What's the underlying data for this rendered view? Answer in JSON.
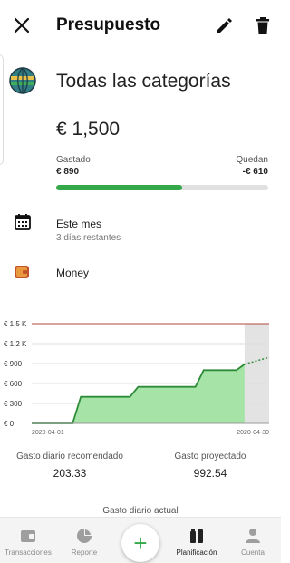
{
  "header": {
    "title": "Presupuesto"
  },
  "budget": {
    "category": "Todas las categorías",
    "amount": "€ 1,500",
    "spent_label": "Gastado",
    "spent_value": "€ 890",
    "remaining_label": "Quedan",
    "remaining_value": "-€ 610",
    "progress": 0.593,
    "progress_color": "#35a84a"
  },
  "period": {
    "label": "Este mes",
    "sublabel": "3 días restantes"
  },
  "account": {
    "label": "Money"
  },
  "chart_data": {
    "type": "area",
    "x_start": "2020-04-01",
    "x_end": "2020-04-30",
    "xlabels": [
      "2020-04-01",
      "2020-04-30"
    ],
    "yticks": [
      {
        "value": 0,
        "label": "€ 0"
      },
      {
        "value": 300,
        "label": "€ 300"
      },
      {
        "value": 600,
        "label": "€ 600"
      },
      {
        "value": 900,
        "label": "€ 900"
      },
      {
        "value": 1200,
        "label": "€ 1.2 K"
      },
      {
        "value": 1500,
        "label": "€ 1.5 K"
      }
    ],
    "ylim": [
      0,
      1500
    ],
    "budget_limit": 1500,
    "series": [
      {
        "values": [
          {
            "x": "2020-04-01",
            "y": 0
          },
          {
            "x": "2020-04-06",
            "y": 0
          },
          {
            "x": "2020-04-07",
            "y": 400
          },
          {
            "x": "2020-04-13",
            "y": 400
          },
          {
            "x": "2020-04-14",
            "y": 550
          },
          {
            "x": "2020-04-21",
            "y": 550
          },
          {
            "x": "2020-04-22",
            "y": 800
          },
          {
            "x": "2020-04-26",
            "y": 800
          },
          {
            "x": "2020-04-27",
            "y": 890
          }
        ]
      }
    ],
    "projection": [
      {
        "x": "2020-04-27",
        "y": 890
      },
      {
        "x": "2020-04-30",
        "y": 993
      }
    ],
    "colors": {
      "fill": "#a5e3a6",
      "line": "#2e8b3a",
      "limit": "#b0463d",
      "projection_area": "#e3e3e3"
    }
  },
  "stats": {
    "recommended_label": "Gasto diario recomendado",
    "recommended_value": "203.33",
    "projected_label": "Gasto proyectado",
    "projected_value": "992.54",
    "daily_label": "Gasto diario actual"
  },
  "nav": {
    "items": [
      {
        "label": "Transacciones",
        "icon": "wallet-icon"
      },
      {
        "label": "Reporte",
        "icon": "pie-chart-icon"
      },
      {
        "label": "Planificación",
        "icon": "planning-icon"
      },
      {
        "label": "Cuenta",
        "icon": "account-icon"
      }
    ],
    "add_label": "+"
  }
}
